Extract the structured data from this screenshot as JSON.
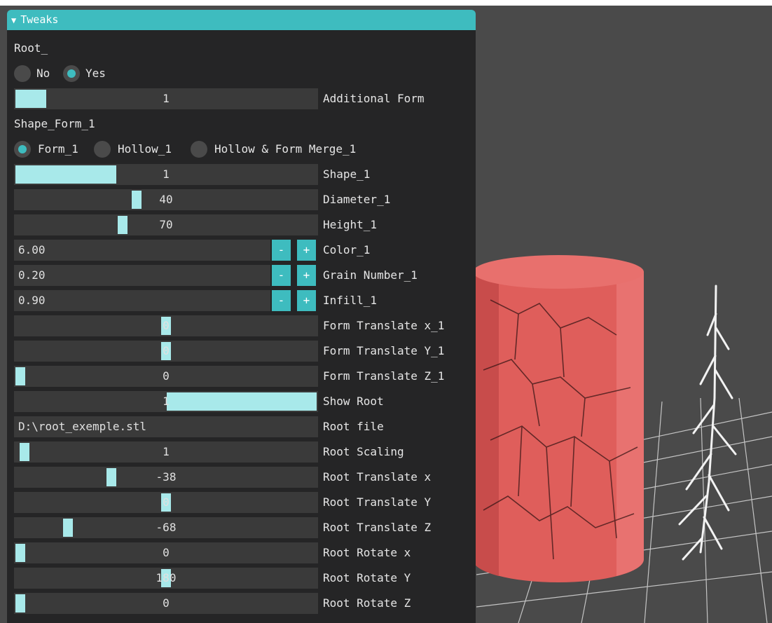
{
  "panel": {
    "title": "Tweaks",
    "collapse_icon": "triangle-down-icon"
  },
  "root_section": {
    "label": "Root_",
    "radio": [
      {
        "label": "No",
        "selected": false
      },
      {
        "label": "Yes",
        "selected": true
      }
    ]
  },
  "additional_form": {
    "value": "1",
    "label": "Additional Form",
    "fill": 0.11
  },
  "shape_section": {
    "label": "Shape_Form_1",
    "radio": [
      {
        "label": "Form_1",
        "selected": true
      },
      {
        "label": "Hollow_1",
        "selected": false
      },
      {
        "label": "Hollow & Form Merge_1",
        "selected": false
      }
    ]
  },
  "sliders_a": [
    {
      "value": "1",
      "label": "Shape_1",
      "fill": 0.34
    },
    {
      "value": "40",
      "label": "Diameter_1",
      "fill": 0.4
    },
    {
      "value": "70",
      "label": "Height_1",
      "fill": 0.36
    }
  ],
  "steppers": [
    {
      "value": "6.00",
      "label": "Color_1",
      "minus": "-",
      "plus": "+"
    },
    {
      "value": "0.20",
      "label": "Grain Number_1",
      "minus": "-",
      "plus": "+"
    },
    {
      "value": "0.90",
      "label": "Infill_1",
      "minus": "-",
      "plus": "+"
    }
  ],
  "sliders_b": [
    {
      "value": "0",
      "label": "Form Translate x_1",
      "fill": 0.5
    },
    {
      "value": "0",
      "label": "Form Translate Y_1",
      "fill": 0.5
    },
    {
      "value": "0",
      "label": "Form Translate Z_1",
      "fill": 0.0
    },
    {
      "value": "1",
      "label": "Show Root",
      "fill": 1.0
    }
  ],
  "root_file": {
    "value": "D:\\root_exemple.stl",
    "label": "Root file"
  },
  "sliders_c": [
    {
      "value": "1",
      "label": "Root Scaling",
      "fill": 0.02
    },
    {
      "value": "-38",
      "label": "Root Translate x",
      "fill": 0.31
    },
    {
      "value": "0",
      "label": "Root Translate Y",
      "fill": 0.5
    },
    {
      "value": "-68",
      "label": "Root Translate Z",
      "fill": 0.16
    },
    {
      "value": "0",
      "label": "Root Rotate x",
      "fill": 0.0
    },
    {
      "value": "180",
      "label": "Root Rotate Y",
      "fill": 0.5
    },
    {
      "value": "0",
      "label": "Root Rotate Z",
      "fill": 0.0
    }
  ],
  "colors": {
    "accent": "#3ebcbf",
    "slider_grab": "#a8e9ea",
    "panel_bg": "#252526",
    "viewport_bg": "#4a4a4a",
    "cylinder": "#e06060"
  }
}
